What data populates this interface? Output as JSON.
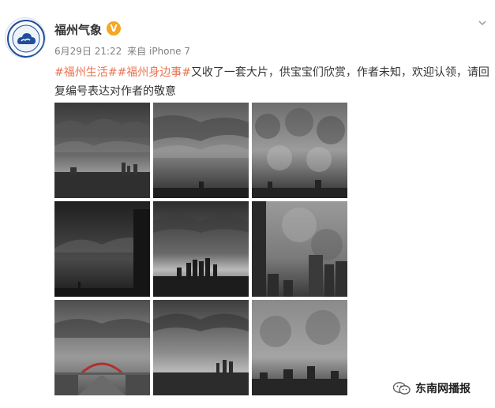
{
  "post": {
    "author": "福州气象",
    "verified_icon": "verified-badge-icon",
    "avatar_icon": "cloud-emblem-icon",
    "time": "6月29日 21:22",
    "source_prefix": "来自",
    "source_device": "iPhone 7",
    "tags": [
      "#福州生活#",
      "#福州身边事#"
    ],
    "text": "又收了一套大片，供宝宝们欣赏，作者未知，欢迎认领，请回复编号表达对作者的敬意",
    "images": [
      {
        "icon": "storm-cloud-city-photo"
      },
      {
        "icon": "storm-cloud-photo"
      },
      {
        "icon": "storm-cloud-photo"
      },
      {
        "icon": "storm-cloud-tower-photo"
      },
      {
        "icon": "storm-cloud-skyline-photo"
      },
      {
        "icon": "storm-cloud-building-photo"
      },
      {
        "icon": "storm-cloud-bridge-photo"
      },
      {
        "icon": "storm-cloud-city-photo"
      },
      {
        "icon": "storm-cloud-city-photo"
      }
    ]
  },
  "watermark": {
    "icon": "wechat-icon",
    "text": "东南网播报"
  },
  "colors": {
    "tag": "#eb7350",
    "text": "#333333",
    "meta": "#808080",
    "verified": "#f5a623"
  }
}
